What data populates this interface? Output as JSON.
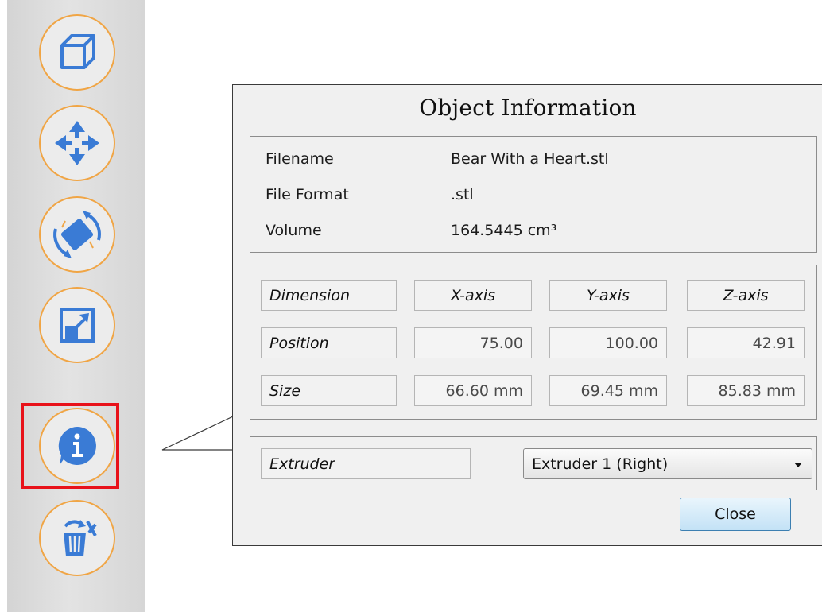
{
  "toolbar": {
    "tools": [
      {
        "name": "cube",
        "icon": "cube-icon"
      },
      {
        "name": "move",
        "icon": "move-arrows-icon"
      },
      {
        "name": "rotate",
        "icon": "rotate-icon"
      },
      {
        "name": "scale",
        "icon": "scale-icon"
      },
      {
        "name": "info",
        "icon": "info-icon",
        "selected": true
      },
      {
        "name": "delete",
        "icon": "trash-icon"
      }
    ],
    "accent": "#f0a545",
    "highlight_color": "#e8121a",
    "icon_blue": "#3a7bd5"
  },
  "dialog": {
    "title": "Object Information",
    "info": {
      "filename_label": "Filename",
      "filename_value": "Bear With a Heart.stl",
      "format_label": "File Format",
      "format_value": ".stl",
      "volume_label": "Volume",
      "volume_value": "164.5445 cm³"
    },
    "dimensions": {
      "header_label": "Dimension",
      "x_header": "X-axis",
      "y_header": "Y-axis",
      "z_header": "Z-axis",
      "position_label": "Position",
      "position_x": "75.00",
      "position_y": "100.00",
      "position_z": "42.91",
      "size_label": "Size",
      "size_x": "66.60 mm",
      "size_y": "69.45 mm",
      "size_z": "85.83 mm"
    },
    "extruder": {
      "label": "Extruder",
      "selected": "Extruder 1 (Right)"
    },
    "close_label": "Close"
  }
}
